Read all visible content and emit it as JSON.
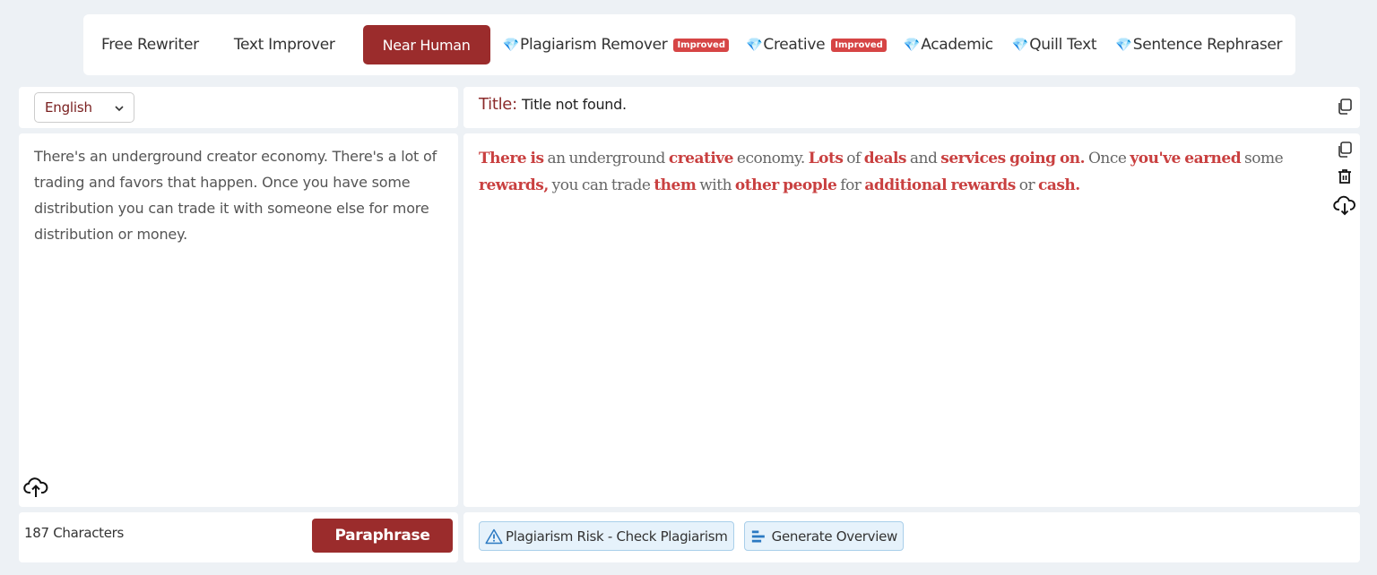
{
  "tabs": [
    {
      "label": "Free Rewriter",
      "premium": false,
      "badge": ""
    },
    {
      "label": "Text Improver",
      "premium": false,
      "badge": ""
    },
    {
      "label": "Near Human",
      "premium": false,
      "badge": "",
      "active": true
    },
    {
      "label": "Plagiarism Remover",
      "premium": true,
      "badge": "Improved"
    },
    {
      "label": "Creative",
      "premium": true,
      "badge": "Improved"
    },
    {
      "label": "Academic",
      "premium": true,
      "badge": ""
    },
    {
      "label": "Quill Text",
      "premium": true,
      "badge": ""
    },
    {
      "label": "Sentence Rephraser",
      "premium": true,
      "badge": ""
    }
  ],
  "language": {
    "selected": "English"
  },
  "title": {
    "label": "Title:",
    "value": "Title not found."
  },
  "input": {
    "text": "There's an underground creator economy. There's a lot of trading and favors that happen. Once you have some distribution you can trade it with someone else for more distribution or money."
  },
  "output": {
    "segments": [
      {
        "text": "There is",
        "changed": true
      },
      {
        "text": " an underground ",
        "changed": false
      },
      {
        "text": "creative",
        "changed": true
      },
      {
        "text": " economy. ",
        "changed": false
      },
      {
        "text": "Lots",
        "changed": true
      },
      {
        "text": " of ",
        "changed": false
      },
      {
        "text": "deals",
        "changed": true
      },
      {
        "text": " and ",
        "changed": false
      },
      {
        "text": "services going on.",
        "changed": true
      },
      {
        "text": " Once ",
        "changed": false
      },
      {
        "text": "you've earned",
        "changed": true
      },
      {
        "text": " some ",
        "changed": false
      },
      {
        "text": "rewards,",
        "changed": true
      },
      {
        "text": " you can trade ",
        "changed": false
      },
      {
        "text": "them",
        "changed": true
      },
      {
        "text": " with ",
        "changed": false
      },
      {
        "text": "other people",
        "changed": true
      },
      {
        "text": " for ",
        "changed": false
      },
      {
        "text": "additional rewards",
        "changed": true
      },
      {
        "text": " or ",
        "changed": false
      },
      {
        "text": "cash.",
        "changed": true
      }
    ]
  },
  "footer": {
    "char_count": "187 Characters",
    "paraphrase_label": "Paraphrase",
    "plagiarism_label": "Plagiarism Risk - Check Plagiarism",
    "overview_label": "Generate Overview"
  },
  "icons": {
    "premium": "gem-icon",
    "copy": "copy-icon",
    "delete": "trash-icon",
    "download": "cloud-download-icon",
    "upload": "cloud-upload-icon",
    "warning": "warning-icon",
    "overview": "align-left-icon"
  },
  "colors": {
    "accent": "#9b2c2c",
    "highlight": "#c94040",
    "badge": "#d64545",
    "background": "#edf1f5"
  }
}
